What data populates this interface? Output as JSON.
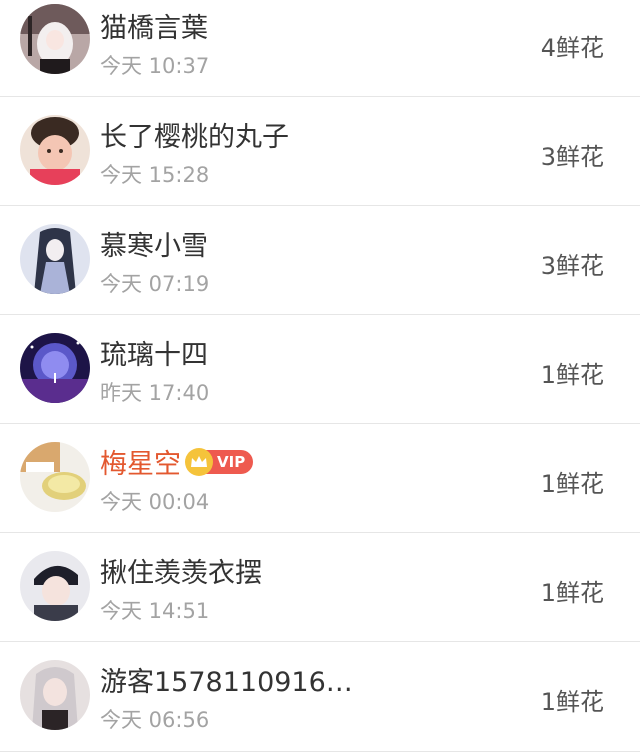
{
  "rows": [
    {
      "name": "猫橋言葉",
      "time": "今天 10:37",
      "flowers": "4鲜花",
      "vip": false
    },
    {
      "name": "长了樱桃的丸子",
      "time": "今天 15:28",
      "flowers": "3鲜花",
      "vip": false
    },
    {
      "name": "慕寒小雪",
      "time": "今天 07:19",
      "flowers": "3鲜花",
      "vip": false
    },
    {
      "name": "琉璃十四",
      "time": "昨天 17:40",
      "flowers": "1鲜花",
      "vip": false
    },
    {
      "name": "梅星空",
      "time": "今天 00:04",
      "flowers": "1鲜花",
      "vip": true,
      "vip_label": "VIP"
    },
    {
      "name": "揪住羡羡衣摆",
      "time": "今天 14:51",
      "flowers": "1鲜花",
      "vip": false
    },
    {
      "name": "游客1578110916…",
      "time": "今天 06:56",
      "flowers": "1鲜花",
      "vip": false
    }
  ],
  "colors": {
    "vip_name": "#e3582f",
    "vip_badge": "#ee5a4f",
    "crown": "#f5c33b",
    "divider": "#e6e6e6"
  }
}
